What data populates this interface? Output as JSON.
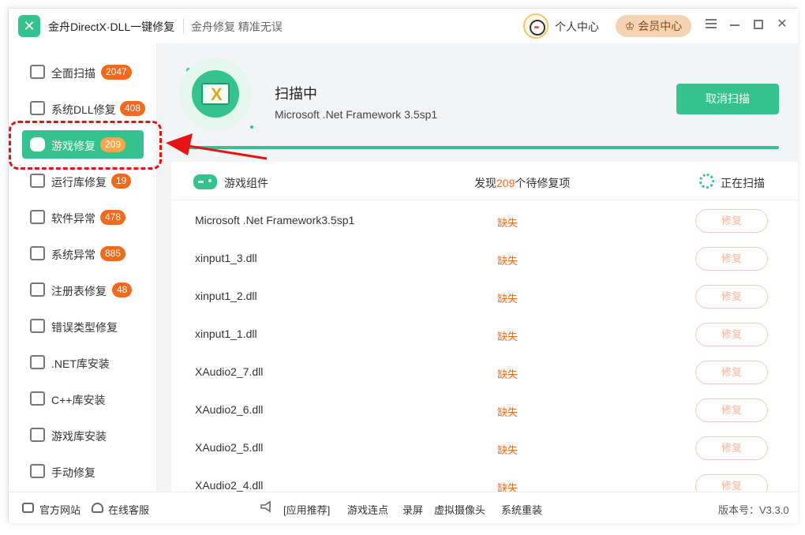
{
  "titlebar": {
    "app_title": "金舟DirectX·DLL一键修复",
    "app_subtitle": "金舟修复 精准无误",
    "personal_center": "个人中心",
    "vip_center": "会员中心"
  },
  "sidebar": {
    "items": [
      {
        "label": "全面扫描",
        "badge": "2047"
      },
      {
        "label": "系统DLL修复",
        "badge": "408"
      },
      {
        "label": "游戏修复",
        "badge": "209"
      },
      {
        "label": "运行库修复",
        "badge": "19"
      },
      {
        "label": "软件异常",
        "badge": "478"
      },
      {
        "label": "系统异常",
        "badge": "885"
      },
      {
        "label": "注册表修复",
        "badge": "48"
      },
      {
        "label": "错误类型修复",
        "badge": null
      },
      {
        "label": ".NET库安装",
        "badge": null
      },
      {
        "label": "C++库安装",
        "badge": null
      },
      {
        "label": "游戏库安装",
        "badge": null
      },
      {
        "label": "手动修复",
        "badge": null
      }
    ]
  },
  "scan": {
    "title": "扫描中",
    "current_file": "Microsoft .Net Framework 3.5sp1",
    "cancel_label": "取消扫描",
    "progress": 1.0
  },
  "list": {
    "header_label": "游戏组件",
    "found_prefix": "发现",
    "found_count": "209",
    "found_suffix": "个待修复项",
    "scanning_label": "正在扫描",
    "rows": [
      {
        "name": "Microsoft .Net Framework3.5sp1",
        "status": "缺失",
        "action": "修复"
      },
      {
        "name": "xinput1_3.dll",
        "status": "缺失",
        "action": "修复"
      },
      {
        "name": "xinput1_2.dll",
        "status": "缺失",
        "action": "修复"
      },
      {
        "name": "xinput1_1.dll",
        "status": "缺失",
        "action": "修复"
      },
      {
        "name": "XAudio2_7.dll",
        "status": "缺失",
        "action": "修复"
      },
      {
        "name": "XAudio2_6.dll",
        "status": "缺失",
        "action": "修复"
      },
      {
        "name": "XAudio2_5.dll",
        "status": "缺失",
        "action": "修复"
      },
      {
        "name": "XAudio2_4.dll",
        "status": "缺失",
        "action": "修复"
      }
    ]
  },
  "footer": {
    "official_site": "官方网站",
    "online_service": "在线客服",
    "recommend": "[应用推荐]",
    "links": [
      "游戏连点",
      "录屏",
      "虚拟摄像头",
      "系统重装"
    ],
    "version": "版本号：V3.3.0"
  },
  "colors": {
    "accent": "#34c38f",
    "badge": "#f26a1b",
    "highlight": "#e41414"
  }
}
